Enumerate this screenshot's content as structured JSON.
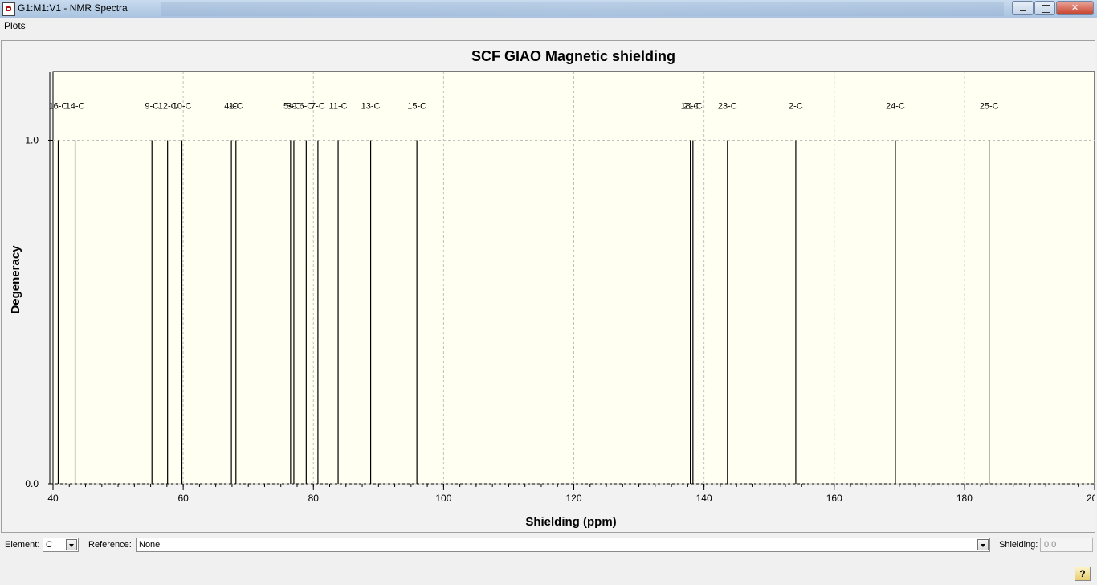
{
  "window": {
    "title": "G1:M1:V1 - NMR Spectra"
  },
  "menu": {
    "plots": "Plots"
  },
  "controls": {
    "element_label": "Element:",
    "element_value": "C",
    "reference_label": "Reference:",
    "reference_value": "None",
    "shielding_label": "Shielding:",
    "shielding_value": "0.0"
  },
  "help": {
    "icon": "help-icon",
    "glyph": "?"
  },
  "colors": {
    "plot_bg": "#fffff2",
    "grid": "#c0c0c0",
    "bar": "#000000"
  },
  "chart_data": {
    "type": "bar",
    "title": "SCF GIAO Magnetic shielding",
    "xlabel": "Shielding (ppm)",
    "ylabel": "Degeneracy",
    "xlim": [
      40,
      200
    ],
    "ylim": [
      0,
      1.2
    ],
    "xticks": [
      "40",
      "60",
      "80",
      "100",
      "120",
      "140",
      "160",
      "180",
      "200"
    ],
    "yticks": [
      "0.0",
      "1.0"
    ],
    "grid": true,
    "peaks": [
      {
        "label": "16-C",
        "x": 40.8,
        "y": 1.0
      },
      {
        "label": "14-C",
        "x": 43.4,
        "y": 1.0
      },
      {
        "label": "9-C",
        "x": 55.2,
        "y": 1.0
      },
      {
        "label": "12-C",
        "x": 57.6,
        "y": 1.0
      },
      {
        "label": "10-C",
        "x": 59.8,
        "y": 1.0
      },
      {
        "label": "4-C",
        "x": 67.4,
        "y": 1.0
      },
      {
        "label": "1-C",
        "x": 68.1,
        "y": 1.0
      },
      {
        "label": "5-C",
        "x": 76.5,
        "y": 1.0
      },
      {
        "label": "3-C",
        "x": 77.0,
        "y": 1.0
      },
      {
        "label": "6-C",
        "x": 78.9,
        "y": 1.0
      },
      {
        "label": "7-C",
        "x": 80.7,
        "y": 1.0
      },
      {
        "label": "11-C",
        "x": 83.8,
        "y": 1.0
      },
      {
        "label": "13-C",
        "x": 88.8,
        "y": 1.0
      },
      {
        "label": "15-C",
        "x": 95.9,
        "y": 1.0
      },
      {
        "label": "18-C",
        "x": 137.9,
        "y": 1.0
      },
      {
        "label": "21-C",
        "x": 138.3,
        "y": 1.0
      },
      {
        "label": "23-C",
        "x": 143.6,
        "y": 1.0
      },
      {
        "label": "2-C",
        "x": 154.1,
        "y": 1.0
      },
      {
        "label": "24-C",
        "x": 169.4,
        "y": 1.0
      },
      {
        "label": "25-C",
        "x": 183.8,
        "y": 1.0
      }
    ]
  }
}
